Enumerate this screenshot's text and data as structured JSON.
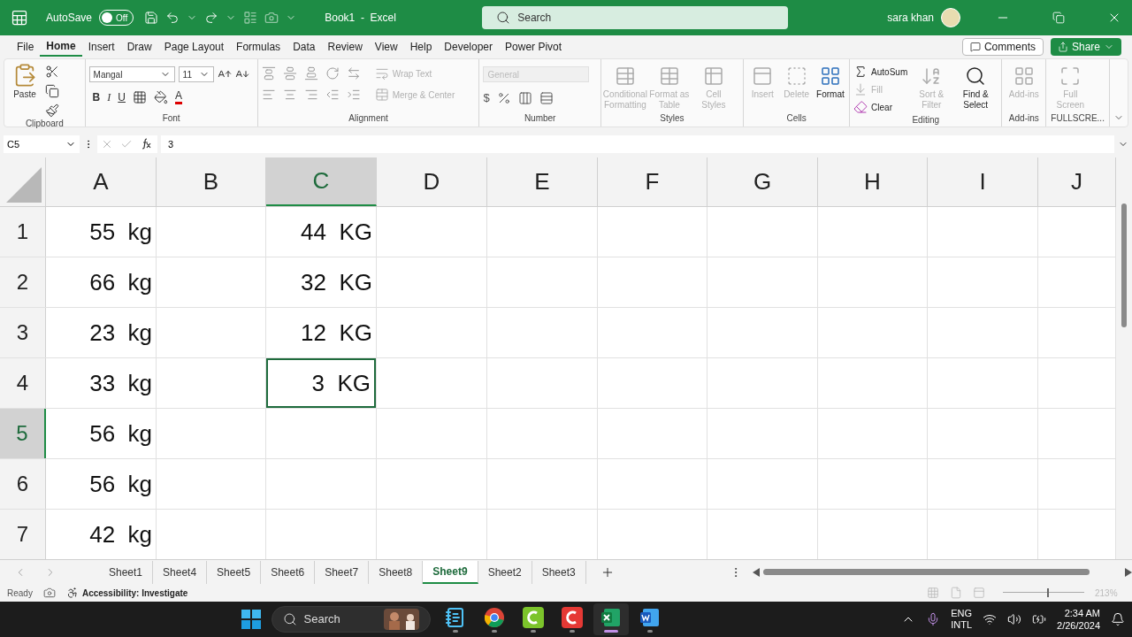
{
  "title_bar": {
    "autosave_label": "AutoSave",
    "autosave_toggle": {
      "label": "Off",
      "on": false
    },
    "title": "Book1  -  Excel",
    "search": {
      "placeholder": "Search"
    },
    "user_name": "sara khan"
  },
  "menu_tabs": [
    {
      "label": "File",
      "selected": false
    },
    {
      "label": "Home",
      "selected": true
    },
    {
      "label": "Insert",
      "selected": false
    },
    {
      "label": "Draw",
      "selected": false
    },
    {
      "label": "Page Layout",
      "selected": false
    },
    {
      "label": "Formulas",
      "selected": false
    },
    {
      "label": "Data",
      "selected": false
    },
    {
      "label": "Review",
      "selected": false
    },
    {
      "label": "View",
      "selected": false
    },
    {
      "label": "Help",
      "selected": false
    },
    {
      "label": "Developer",
      "selected": false
    },
    {
      "label": "Power Pivot",
      "selected": false
    }
  ],
  "comments_button": "Comments",
  "share_button": "Share",
  "ribbon": {
    "clipboard": {
      "label": "Clipboard",
      "paste": "Paste"
    },
    "font": {
      "label": "Font",
      "font_name": "Mangal",
      "font_size": "11",
      "bold": "B",
      "italic": "I",
      "underline": "U",
      "font_color": "A"
    },
    "alignment": {
      "label": "Alignment",
      "wrap_text": {
        "label": "Wrap Text",
        "disabled": true
      },
      "merge_center": {
        "label": "Merge & Center",
        "disabled": true
      }
    },
    "number": {
      "label": "Number",
      "format": {
        "value": "General",
        "disabled": true
      },
      "currency": "$"
    },
    "styles": {
      "label": "Styles",
      "items": [
        {
          "label": "Conditional Formatting",
          "disabled": true
        },
        {
          "label": "Format as Table",
          "disabled": true
        },
        {
          "label": "Cell Styles",
          "disabled": true
        }
      ]
    },
    "cells": {
      "label": "Cells",
      "items": [
        {
          "label": "Insert",
          "disabled": true
        },
        {
          "label": "Delete",
          "disabled": true
        },
        {
          "label": "Format",
          "disabled": false
        }
      ]
    },
    "editing": {
      "label": "Editing",
      "autosum": {
        "label": "AutoSum",
        "disabled": false
      },
      "fill": {
        "label": "Fill",
        "disabled": true
      },
      "clear": {
        "label": "Clear",
        "disabled": false
      },
      "sort_filter": {
        "label": "Sort & Filter",
        "disabled": true
      },
      "find_select": {
        "label": "Find & Select",
        "disabled": false
      }
    },
    "addins": {
      "label": "Add-ins",
      "button": {
        "label": "Add-ins",
        "disabled": true
      }
    },
    "fullscreen": {
      "label": "FULLSCRE...",
      "button": {
        "label": "Full Screen",
        "disabled": true
      }
    }
  },
  "formula_bar": {
    "name_box": "C5",
    "formula": "3"
  },
  "grid": {
    "columns": [
      {
        "label": "A",
        "selected": false
      },
      {
        "label": "B",
        "selected": false
      },
      {
        "label": "C",
        "selected": true
      },
      {
        "label": "D",
        "selected": false
      },
      {
        "label": "E",
        "selected": false
      },
      {
        "label": "F",
        "selected": false
      },
      {
        "label": "G",
        "selected": false
      },
      {
        "label": "H",
        "selected": false
      },
      {
        "label": "I",
        "selected": false
      },
      {
        "label": "J",
        "selected": false
      }
    ],
    "rows": [
      {
        "number": "1",
        "selected": false,
        "cells": [
          {
            "text": "55  kg",
            "active": false
          },
          null,
          {
            "text": "44  KG",
            "active": false
          }
        ]
      },
      {
        "number": "2",
        "selected": false,
        "cells": [
          {
            "text": "66  kg",
            "active": false
          },
          null,
          {
            "text": "32  KG",
            "active": false
          }
        ]
      },
      {
        "number": "3",
        "selected": false,
        "cells": [
          {
            "text": "23  kg",
            "active": false
          },
          null,
          {
            "text": "12  KG",
            "active": false
          }
        ]
      },
      {
        "number": "4",
        "selected": false,
        "cells": [
          {
            "text": "33  kg",
            "active": false
          },
          null,
          {
            "text": "3  KG",
            "active": true
          }
        ]
      },
      {
        "number": "5",
        "selected": true,
        "cells": [
          {
            "text": "56  kg",
            "active": false
          }
        ]
      },
      {
        "number": "6",
        "selected": false,
        "cells": [
          {
            "text": "56  kg",
            "active": false
          }
        ]
      },
      {
        "number": "7",
        "selected": false,
        "cells": [
          {
            "text": "42  kg",
            "active": false
          }
        ]
      }
    ]
  },
  "sheet_tabs": [
    {
      "label": "Sheet1",
      "selected": false
    },
    {
      "label": "Sheet4",
      "selected": false
    },
    {
      "label": "Sheet5",
      "selected": false
    },
    {
      "label": "Sheet6",
      "selected": false
    },
    {
      "label": "Sheet7",
      "selected": false
    },
    {
      "label": "Sheet8",
      "selected": false
    },
    {
      "label": "Sheet9",
      "selected": true
    },
    {
      "label": "Sheet2",
      "selected": false
    },
    {
      "label": "Sheet3",
      "selected": false
    }
  ],
  "status_bar": {
    "ready": "Ready",
    "accessibility": "Accessibility: Investigate",
    "zoom": {
      "label": "213%",
      "level": 0.56
    }
  },
  "taskbar": {
    "search": {
      "placeholder": "Search"
    },
    "apps": [
      {
        "kind": "notepad",
        "active": false
      },
      {
        "kind": "chrome",
        "active": false
      },
      {
        "kind": "camtasia",
        "active": false
      },
      {
        "kind": "camrec",
        "active": false
      },
      {
        "kind": "excel",
        "active": true
      },
      {
        "kind": "word",
        "active": false
      }
    ],
    "language": "ENG",
    "layout": "INTL",
    "time": "2:34 AM",
    "date": "2/26/2024"
  }
}
